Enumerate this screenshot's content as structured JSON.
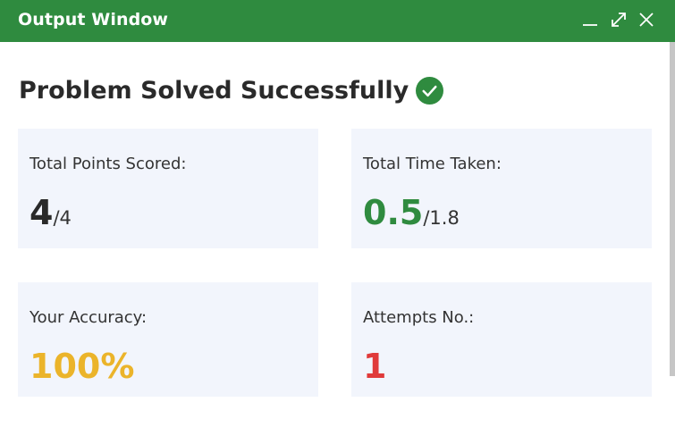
{
  "window": {
    "title": "Output Window",
    "header_color": "#2f8b3f"
  },
  "result": {
    "heading": "Problem Solved Successfully",
    "status_icon": "check-circle-icon",
    "success_color": "#2f8b3f"
  },
  "cards": {
    "points": {
      "label": "Total Points Scored:",
      "value": "4",
      "total": "/4",
      "color": "#2a2a2a"
    },
    "time": {
      "label": "Total Time Taken:",
      "value": "0.5",
      "total": "/1.8",
      "color": "#2f8b3f"
    },
    "accuracy": {
      "label": "Your Accuracy:",
      "value": "100%",
      "color": "#ebb42a"
    },
    "attempts": {
      "label": "Attempts No.:",
      "value": "1",
      "color": "#e03a3a"
    }
  },
  "icons": {
    "minimize": "minimize-icon",
    "maximize": "maximize-icon",
    "close": "close-icon"
  }
}
